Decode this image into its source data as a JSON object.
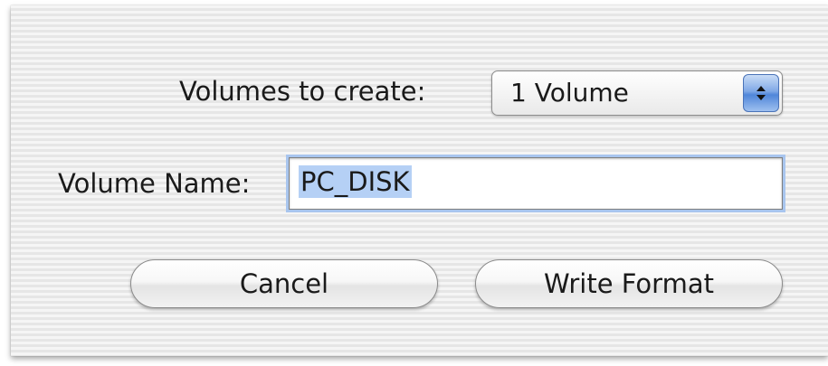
{
  "form": {
    "volumes_label": "Volumes to create:",
    "volumes_selected": "1 Volume",
    "volume_name_label": "Volume Name:",
    "volume_name_value": "PC_DISK"
  },
  "buttons": {
    "cancel_label": "Cancel",
    "write_format_label": "Write Format"
  },
  "icons": {
    "popup_arrows": "up-down-chevron-icon"
  },
  "colors": {
    "selection_highlight": "#b5d0f5",
    "focus_ring": "#a8c5ee",
    "popup_arrow_accent": "#4f86d9"
  }
}
